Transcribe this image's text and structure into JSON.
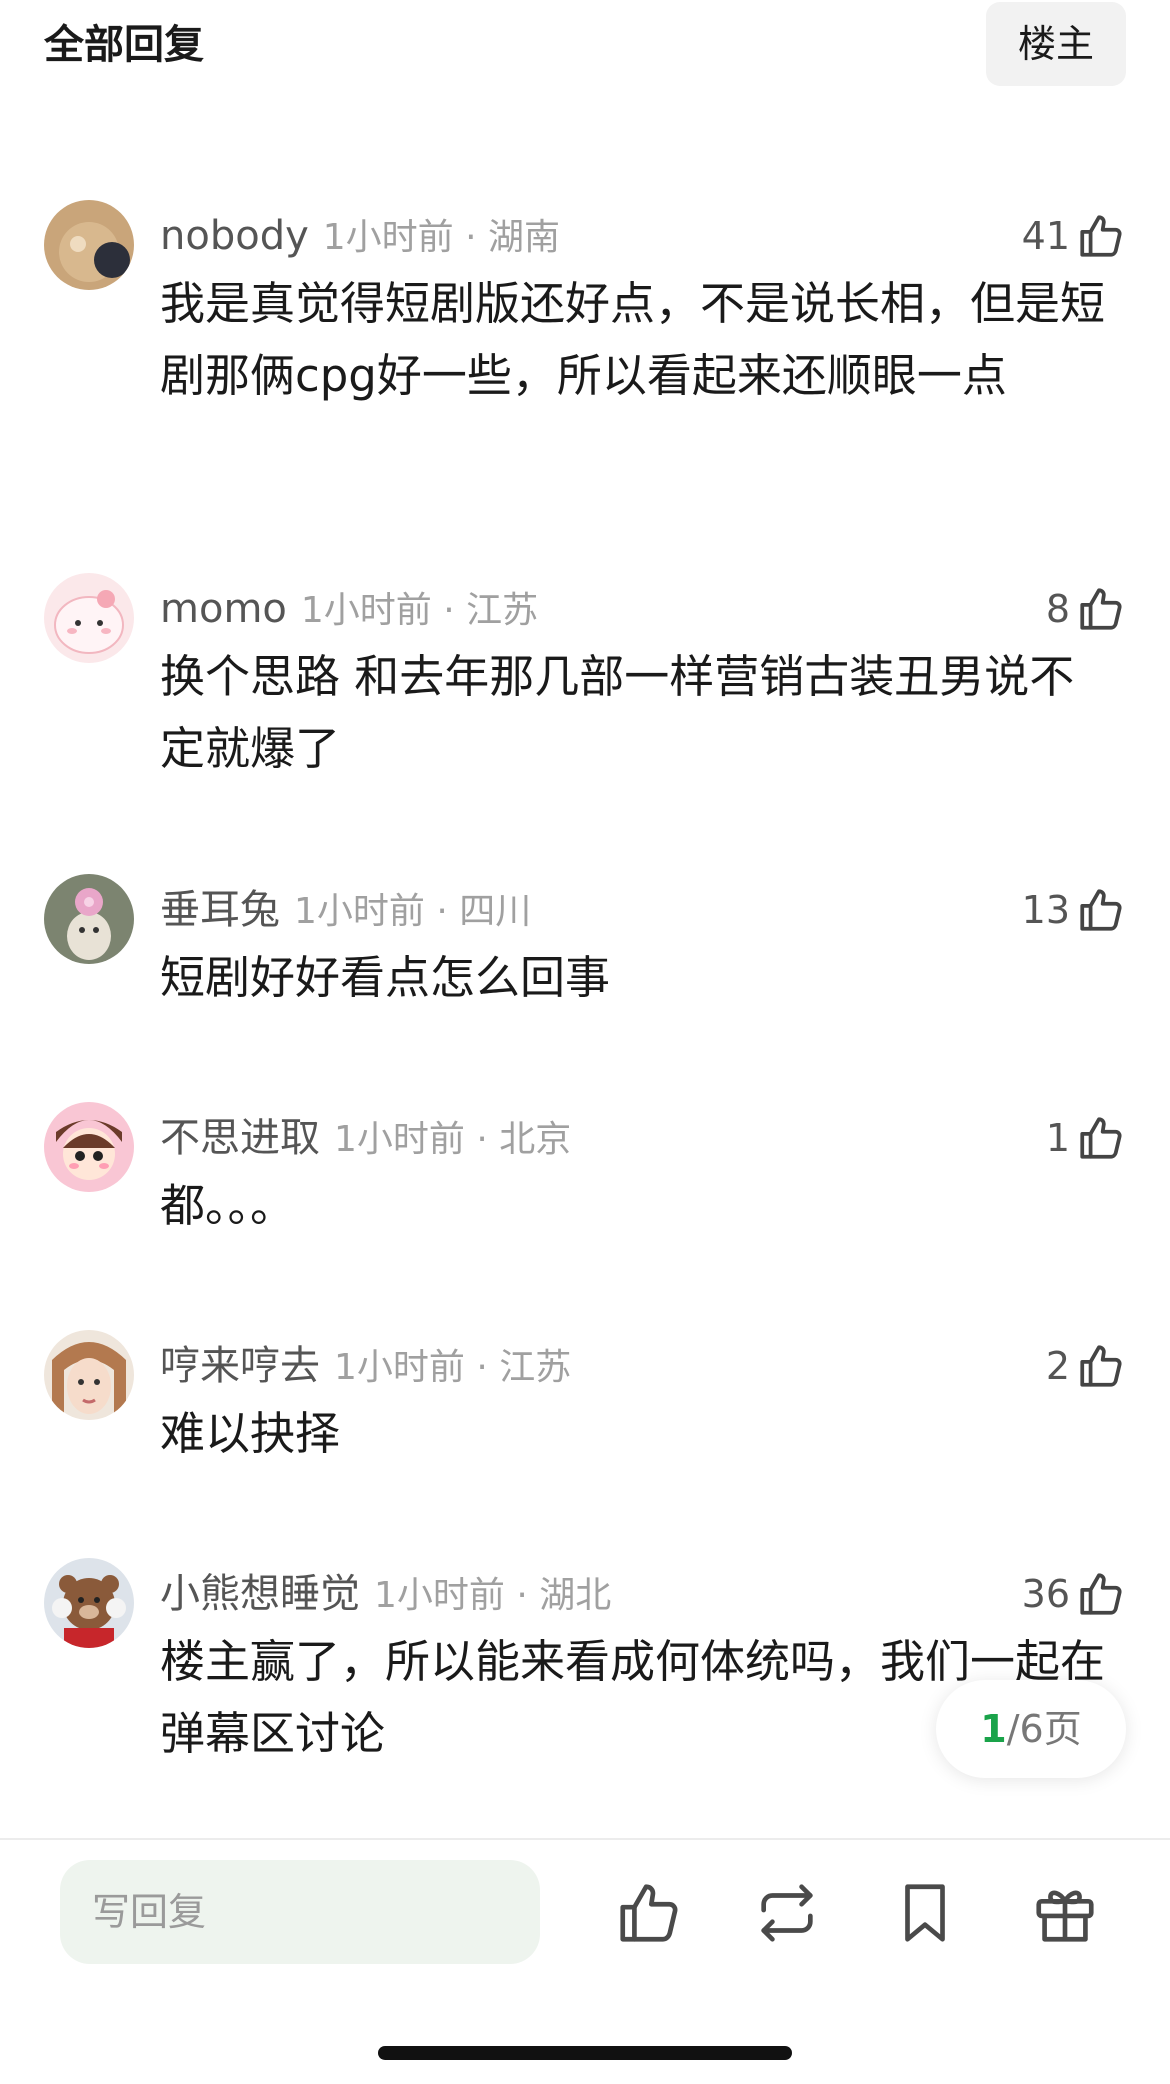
{
  "header": {
    "title": "全部回复",
    "owner_button": "楼主"
  },
  "comments": [
    {
      "username": "nobody",
      "time": "1小时前",
      "location": "湖南",
      "likes": "41",
      "content": "我是真觉得短剧版还好点，不是说长相，但是短剧那俩cpg好一些，所以看起来还顺眼一点"
    },
    {
      "username": "momo",
      "time": "1小时前",
      "location": "江苏",
      "likes": "8",
      "content": "换个思路 和去年那几部一样营销古装丑男说不定就爆了"
    },
    {
      "username": "垂耳兔",
      "time": "1小时前",
      "location": "四川",
      "likes": "13",
      "content": "短剧好好看点怎么回事"
    },
    {
      "username": "不思进取",
      "time": "1小时前",
      "location": "北京",
      "likes": "1",
      "content": "都。。。"
    },
    {
      "username": "哼来哼去",
      "time": "1小时前",
      "location": "江苏",
      "likes": "2",
      "content": "难以抉择"
    },
    {
      "username": "小熊想睡觉",
      "time": "1小时前",
      "location": "湖北",
      "likes": "36",
      "content": "楼主赢了，所以能来看成何体统吗，我们一起在弹幕区讨论"
    }
  ],
  "pagination": {
    "current": "1",
    "rest": "/6页"
  },
  "bottom_bar": {
    "reply_placeholder": "写回复",
    "icons": [
      "thumbs-up-icon",
      "repost-icon",
      "bookmark-icon",
      "gift-icon"
    ]
  },
  "colors": {
    "accent_green": "#1aa34a",
    "input_bg": "#eef4ee",
    "meta_gray": "#a0a0a0"
  }
}
